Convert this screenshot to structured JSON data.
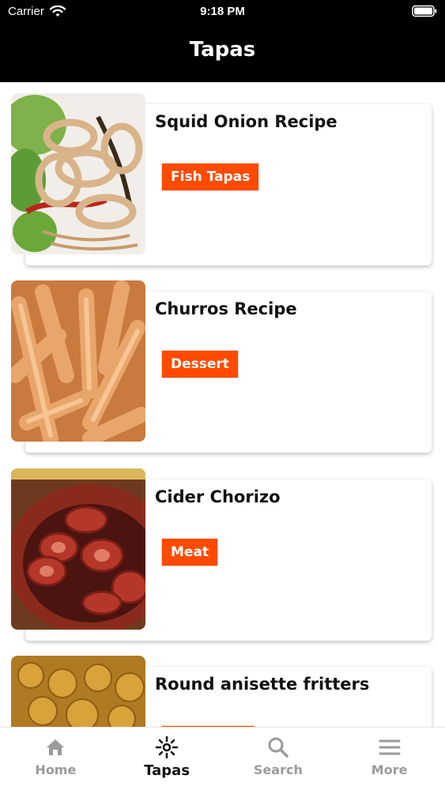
{
  "status_bar": {
    "carrier": "Carrier",
    "time": "9:18 PM"
  },
  "header": {
    "title": "Tapas"
  },
  "items": [
    {
      "title": "Squid Onion Recipe",
      "tag": "Fish Tapas"
    },
    {
      "title": "Churros Recipe",
      "tag": "Dessert"
    },
    {
      "title": "Cider Chorizo",
      "tag": "Meat"
    },
    {
      "title": "Round anisette fritters",
      "tag": ""
    }
  ],
  "tabs": [
    {
      "label": "Home",
      "icon": "home-icon"
    },
    {
      "label": "Tapas",
      "icon": "tapas-icon"
    },
    {
      "label": "Search",
      "icon": "search-icon"
    },
    {
      "label": "More",
      "icon": "menu-icon"
    }
  ],
  "colors": {
    "accent": "#ff4a00",
    "header_bg": "#000000",
    "tab_inactive": "#9a9a9a"
  }
}
